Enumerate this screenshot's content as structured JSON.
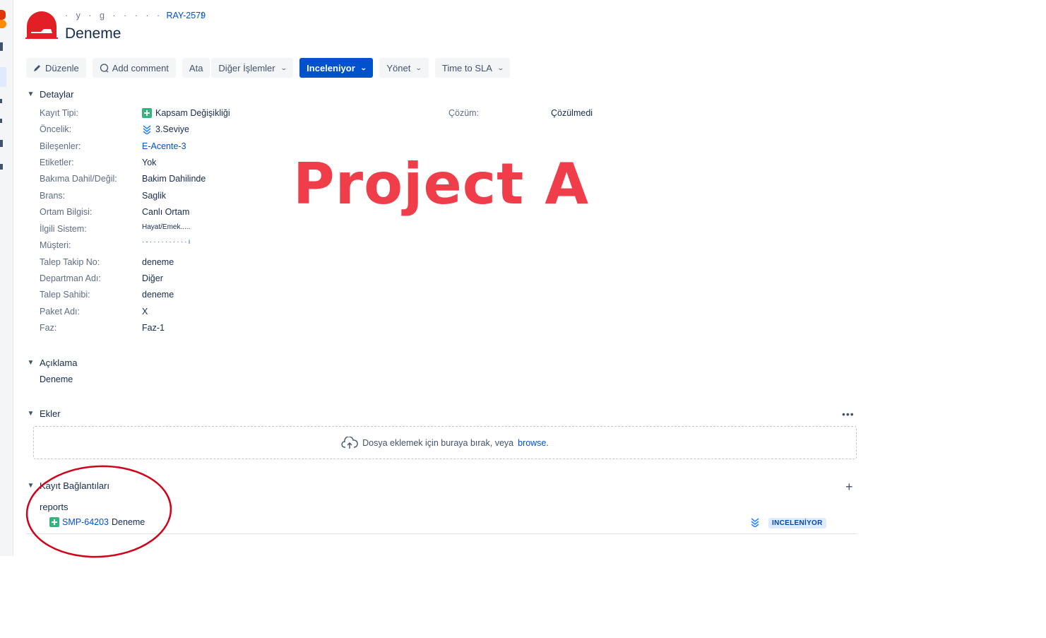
{
  "header": {
    "breadcrumb_redacted": "· y · g · · · · · · · · /",
    "issue_key": "RAY-2579",
    "title": "Deneme"
  },
  "toolbar": {
    "edit": "Düzenle",
    "comment": "Add comment",
    "assign": "Ata",
    "more": "Diğer İşlemler",
    "status": "Inceleniyor",
    "admin": "Yönet",
    "sla": "Time to SLA"
  },
  "details": {
    "title": "Detaylar",
    "fields": [
      {
        "label": "Kayıt Tipi:",
        "value": "Kapsam Değişikliği"
      },
      {
        "label": "Öncelik:",
        "value": "3.Seviye"
      },
      {
        "label": "Bileşenler:",
        "value": "E-Acente-3"
      },
      {
        "label": "Etiketler:",
        "value": "Yok"
      },
      {
        "label": "Bakıma Dahil/Değil:",
        "value": "Bakim Dahilinde"
      },
      {
        "label": "Brans:",
        "value": "Saglik"
      },
      {
        "label": "Ortam Bilgisi:",
        "value": "Canlı Ortam"
      },
      {
        "label": "İlgili Sistem:",
        "value": "Hayat/Emek....."
      },
      {
        "label": "Müşteri:",
        "value": "· - · · · · · · · · · · i"
      },
      {
        "label": "Talep Takip No:",
        "value": "deneme"
      },
      {
        "label": "Departman Adı:",
        "value": "Diğer"
      },
      {
        "label": "Talep Sahibi:",
        "value": "deneme"
      },
      {
        "label": "Paket Adı:",
        "value": "X"
      },
      {
        "label": "Faz:",
        "value": "Faz-1"
      }
    ],
    "resolution_label": "Çözüm:",
    "resolution_value": "Çözülmedi"
  },
  "watermark": "Project A",
  "description": {
    "title": "Açıklama",
    "text": "Deneme"
  },
  "attachments": {
    "title": "Ekler",
    "drop_text": "Dosya eklemek için buraya bırak, veya",
    "browse": "browse",
    "period": "."
  },
  "links": {
    "title": "Kayıt Bağlantıları",
    "type": "reports",
    "items": [
      {
        "key": "SMP-64203",
        "summary": "Deneme",
        "status": "INCELENİYOR"
      }
    ]
  },
  "colors": {
    "primary": "#0052cc",
    "watermark": "#ef3e4a",
    "annotation": "#d0021b",
    "story_green": "#36b37e"
  }
}
